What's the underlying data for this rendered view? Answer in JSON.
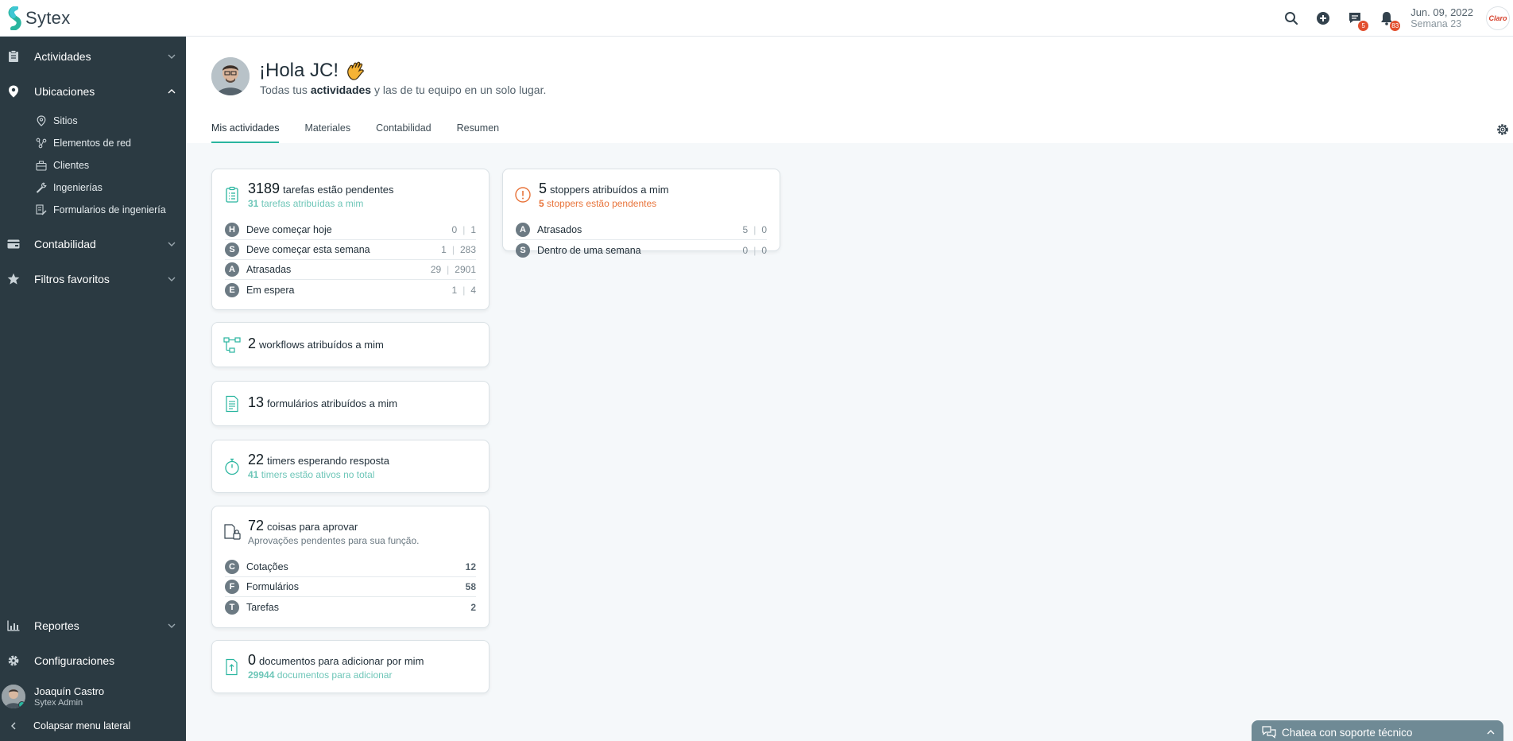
{
  "app": {
    "name": "Sytex"
  },
  "topbar": {
    "date": "Jun. 09, 2022",
    "week": "Semana 23",
    "messages_badge": "5",
    "notifications_badge": "83",
    "client_logo_text": "Claro"
  },
  "sidebar": {
    "items": [
      {
        "label": "Actividades"
      },
      {
        "label": "Ubicaciones"
      },
      {
        "label": "Contabilidad"
      },
      {
        "label": "Filtros favoritos"
      },
      {
        "label": "Reportes"
      },
      {
        "label": "Configuraciones"
      }
    ],
    "sub_items": [
      {
        "label": "Sitios"
      },
      {
        "label": "Elementos de red"
      },
      {
        "label": "Clientes"
      },
      {
        "label": "Ingenierías"
      },
      {
        "label": "Formularios de ingeniería"
      }
    ],
    "user": {
      "name": "Joaquín Castro",
      "role": "Sytex Admin"
    },
    "collapse_label": "Colapsar menu lateral"
  },
  "header": {
    "greeting": "¡Hola JC!",
    "subtitle_pre": "Todas tus",
    "subtitle_bold": "actividades",
    "subtitle_post": "y las de tu equipo en un solo lugar.",
    "tabs": [
      {
        "label": "Mis actividades"
      },
      {
        "label": "Materiales"
      },
      {
        "label": "Contabilidad"
      },
      {
        "label": "Resumen"
      }
    ]
  },
  "cards": {
    "tasks": {
      "count": "3189",
      "title": "tarefas estão pendentes",
      "sub_count": "31",
      "sub_text": "tarefas atribuídas a mim",
      "rows": [
        {
          "letter": "H",
          "label": "Deve começar hoje",
          "a": "0",
          "b": "1"
        },
        {
          "letter": "S",
          "label": "Deve começar esta semana",
          "a": "1",
          "b": "283"
        },
        {
          "letter": "A",
          "label": "Atrasadas",
          "a": "29",
          "b": "2901"
        },
        {
          "letter": "E",
          "label": "Em espera",
          "a": "1",
          "b": "4"
        }
      ]
    },
    "stoppers": {
      "count": "5",
      "title": "stoppers atribuídos a mim",
      "sub_count": "5",
      "sub_text": "stoppers estão pendentes",
      "rows": [
        {
          "letter": "A",
          "label": "Atrasados",
          "a": "5",
          "b": "0"
        },
        {
          "letter": "S",
          "label": "Dentro de uma semana",
          "a": "0",
          "b": "0"
        }
      ]
    },
    "workflows": {
      "count": "2",
      "title": "workflows atribuídos a mim"
    },
    "forms": {
      "count": "13",
      "title": "formulários atribuídos a mim"
    },
    "timers": {
      "count": "22",
      "title": "timers esperando resposta",
      "sub_count": "41",
      "sub_text": "timers estão ativos no total"
    },
    "approvals": {
      "count": "72",
      "title": "coisas para aprovar",
      "sub_text": "Aprovações pendentes para sua função.",
      "rows": [
        {
          "letter": "C",
          "label": "Cotações",
          "value": "12"
        },
        {
          "letter": "F",
          "label": "Formulários",
          "value": "58"
        },
        {
          "letter": "T",
          "label": "Tarefas",
          "value": "2"
        }
      ]
    },
    "documents": {
      "count": "0",
      "title": "documentos para adicionar por mim",
      "sub_count": "29944",
      "sub_text": "documentos para adicionar"
    }
  },
  "chat": {
    "label": "Chatea con soporte técnico"
  },
  "colors": {
    "sidebar": "#2b3a42",
    "accent": "#29b59f",
    "warning": "#e8743b",
    "badge": "#e24f2e"
  }
}
